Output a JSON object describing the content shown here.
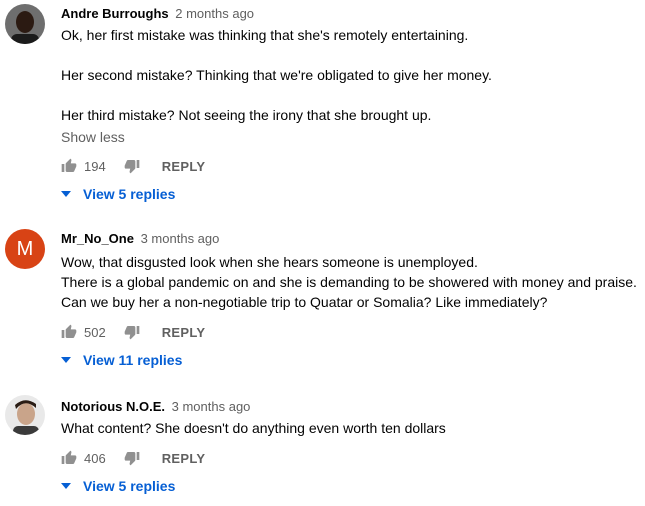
{
  "comments": [
    {
      "author": "Andre Burroughs",
      "time": "2 months ago",
      "avatar": "photo",
      "paragraphs": [
        "Ok, her first mistake was thinking that she's remotely entertaining.",
        "Her second mistake? Thinking that we're obligated to give her money.",
        "Her third mistake? Not seeing the irony that she brought up."
      ],
      "show_less": "Show less",
      "likes": "194",
      "reply_label": "REPLY",
      "view_replies": "View 5 replies"
    },
    {
      "author": "Mr_No_One",
      "time": "3 months ago",
      "avatar": "M",
      "avatar_color": "#d84315",
      "lines": [
        "Wow, that disgusted look when she hears someone is unemployed.",
        "There is a global pandemic on and she is demanding to be showered with money and praise.",
        "Can we buy her a non-negotiable trip to Quatar or Somalia? Like immediately?"
      ],
      "likes": "502",
      "reply_label": "REPLY",
      "view_replies": "View 11 replies"
    },
    {
      "author": "Notorious N.O.E.",
      "time": "3 months ago",
      "avatar": "photo",
      "lines": [
        "What content? She doesn't do anything even worth ten dollars"
      ],
      "likes": "406",
      "reply_label": "REPLY",
      "view_replies": "View 5 replies"
    }
  ],
  "icons": {
    "like": "thumbs-up-icon",
    "dislike": "thumbs-down-icon",
    "expand": "caret-down-icon"
  },
  "colors": {
    "link_blue": "#065fd4",
    "secondary_text": "#606060",
    "avatar_m": "#d84315"
  }
}
